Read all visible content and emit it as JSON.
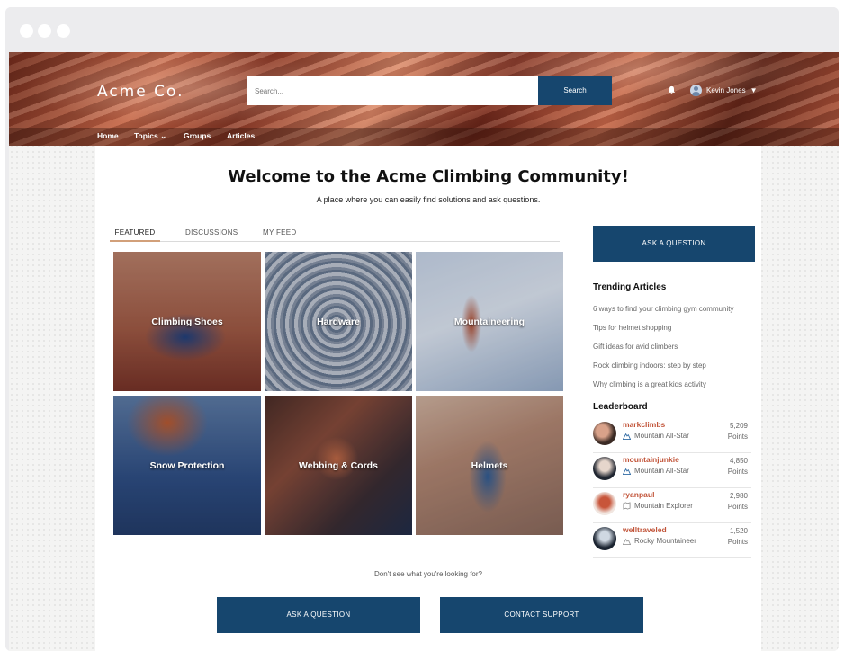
{
  "site": {
    "brand": "Acme Co."
  },
  "search": {
    "placeholder": "Search...",
    "button": "Search"
  },
  "user": {
    "name": "Kevin Jones"
  },
  "nav": {
    "home": "Home",
    "topics": "Topics",
    "groups": "Groups",
    "articles": "Articles"
  },
  "hero": {
    "title": "Welcome to the Acme Climbing Community!",
    "subtitle": "A place where you can easily find solutions and ask questions."
  },
  "tabs": [
    "FEATURED",
    "DISCUSSIONS",
    "MY FEED"
  ],
  "topics": [
    "Climbing Shoes",
    "Hardware",
    "Mountaineering",
    "Snow Protection",
    "Webbing & Cords",
    "Helmets"
  ],
  "sidebar": {
    "ask_button": "ASK A QUESTION",
    "trending_heading": "Trending Articles",
    "trending": [
      "6 ways to find your climbing gym community",
      "Tips for helmet shopping",
      "Gift ideas for avid climbers",
      "Rock climbing indoors: step by step",
      "Why climbing is a great kids activity"
    ],
    "leaderboard_heading": "Leaderboard",
    "leaders": [
      {
        "name": "markclimbs",
        "rank": "Mountain All-Star",
        "points": "5,209",
        "unit": "Points"
      },
      {
        "name": "mountainjunkie",
        "rank": "Mountain All-Star",
        "points": "4,850",
        "unit": "Points"
      },
      {
        "name": "ryanpaul",
        "rank": "Mountain Explorer",
        "points": "2,980",
        "unit": "Points"
      },
      {
        "name": "welltraveled",
        "rank": "Rocky Mountaineer",
        "points": "1,520",
        "unit": "Points"
      }
    ]
  },
  "footer": {
    "prompt": "Don't see what you're looking for?",
    "ask_button": "ASK A QUESTION",
    "support_button": "CONTACT SUPPORT"
  },
  "colors": {
    "primary": "#16466e",
    "accent": "#c2553a",
    "tab_underline": "#d2a07a"
  }
}
